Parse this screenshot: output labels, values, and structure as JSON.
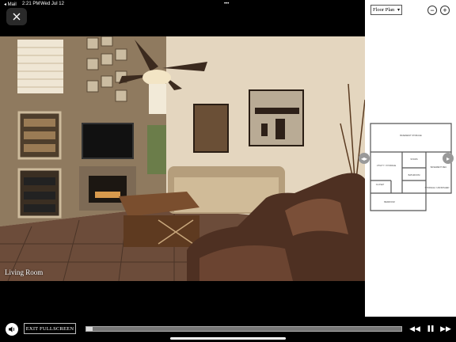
{
  "status_bar": {
    "carrier": "◂ Mail",
    "time": "2:21 PM",
    "date": "Wed Jul 12",
    "dots": "•••"
  },
  "viewer": {
    "caption": "Living Room",
    "close_icon": "close-icon"
  },
  "floor_panel": {
    "select_value": "Floor Plan",
    "zoom_out": "−",
    "zoom_in": "+",
    "rooms": [
      "BASEMENT STORAGE",
      "UTILITY / STORAGE",
      "STAIRS",
      "BATHROOM",
      "CLOSET",
      "BEDROOM",
      "BASEMENT REC",
      "STORAGE / UNFINISHED"
    ]
  },
  "controls": {
    "exit_label": "EXIT FULLSCREEN",
    "progress": 0.02,
    "icons": [
      "volume-icon",
      "rewind-icon",
      "pause-icon",
      "fast-forward-icon"
    ]
  }
}
